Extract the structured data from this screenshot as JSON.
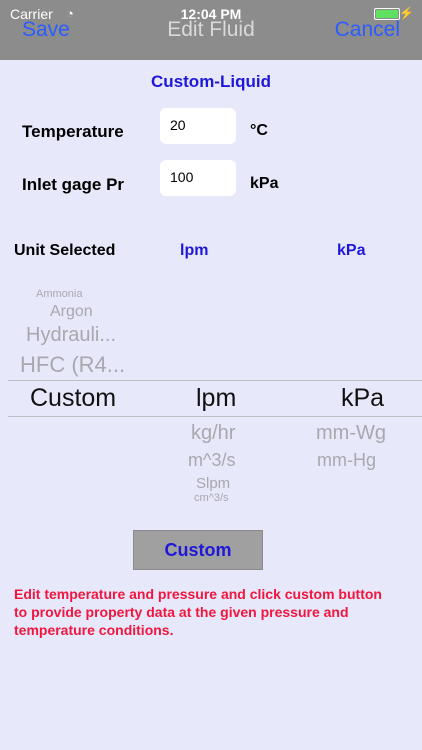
{
  "status_bar": {
    "carrier": "Carrier",
    "time": "12:04 PM"
  },
  "nav": {
    "left": "Save",
    "title": "Edit Fluid",
    "right": "Cancel"
  },
  "fluid_name": "Custom-Liquid",
  "temperature": {
    "label": "Temperature",
    "value": "20",
    "unit": "°C"
  },
  "inlet": {
    "label": "Inlet gage Pr",
    "value": "100",
    "unit": "kPa"
  },
  "unit_selected": {
    "label": "Unit Selected",
    "flow": "lpm",
    "pressure": "kPa"
  },
  "picker": {
    "fluid_above": [
      "Ammonia",
      "Argon",
      "Hydrauli...",
      "HFC (R4..."
    ],
    "fluid_selected": "Custom",
    "flow_selected": "lpm",
    "flow_below": [
      "kg/hr",
      "m^3/s",
      "Slpm",
      "cm^3/s"
    ],
    "pressure_selected": "kPa",
    "pressure_below": [
      "mm-Wg",
      "mm-Hg"
    ]
  },
  "custom_button": "Custom",
  "note": "Edit temperature and pressure and click custom button to provide property data at the given pressure and temperature conditions."
}
